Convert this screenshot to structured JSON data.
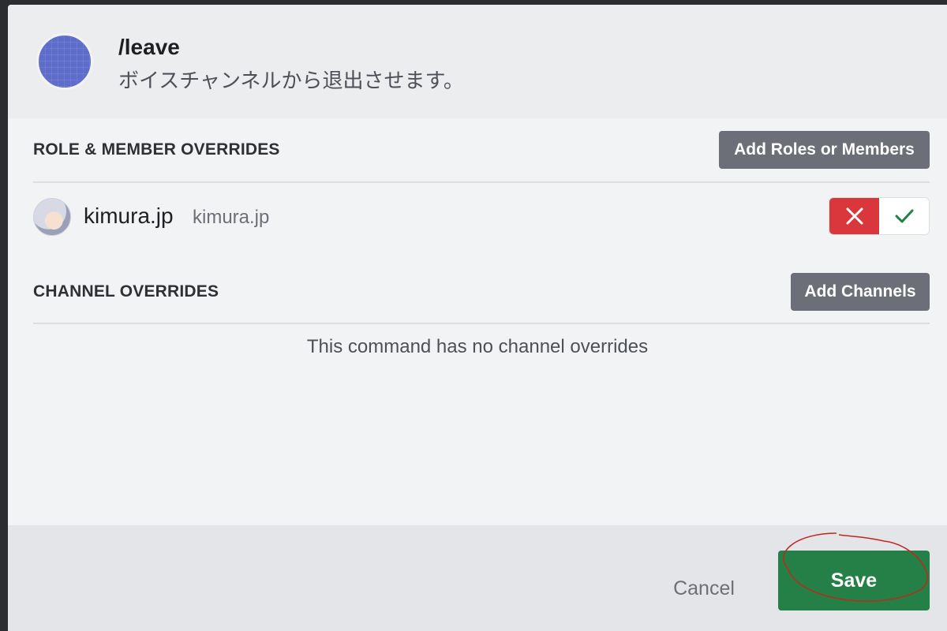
{
  "command": {
    "name": "/leave",
    "description": "ボイスチャンネルから退出させます。"
  },
  "role_member_overrides": {
    "title": "ROLE & MEMBER OVERRIDES",
    "add_button": "Add Roles or Members",
    "members": [
      {
        "name": "kimura.jp",
        "handle": "kimura.jp",
        "permission": "denied"
      }
    ]
  },
  "channel_overrides": {
    "title": "CHANNEL OVERRIDES",
    "add_button": "Add Channels",
    "empty_text": "This command has no channel overrides"
  },
  "footer": {
    "cancel_label": "Cancel",
    "save_label": "Save"
  },
  "colors": {
    "save": "#248046",
    "deny": "#da373c",
    "allow_check": "#248046",
    "command_avatar": "#5d6dc9",
    "annotation": "#c0281f"
  }
}
